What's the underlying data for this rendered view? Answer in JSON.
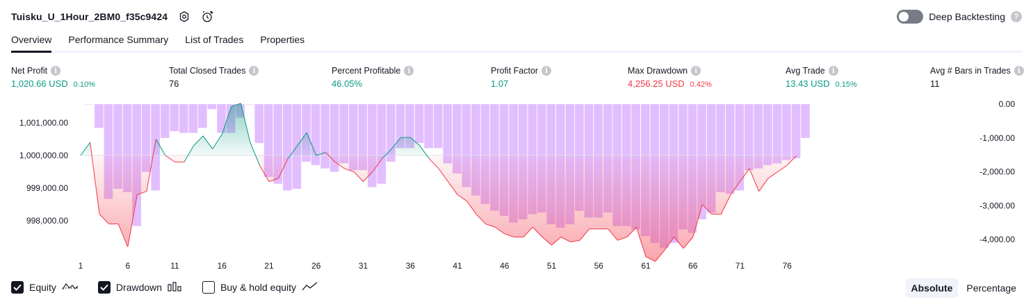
{
  "header": {
    "strategy_name": "Tuisku_U_1Hour_2BM0_f35c9424"
  },
  "deep_backtesting": {
    "label": "Deep Backtesting",
    "help": "?"
  },
  "tabs": [
    {
      "label": "Overview"
    },
    {
      "label": "Performance Summary"
    },
    {
      "label": "List of Trades"
    },
    {
      "label": "Properties"
    }
  ],
  "metrics": [
    {
      "label": "Net Profit",
      "value": "1,020.66 USD",
      "pct": "0.10%",
      "color": "#089981"
    },
    {
      "label": "Total Closed Trades",
      "value": "76",
      "pct": "",
      "color": "#131722"
    },
    {
      "label": "Percent Profitable",
      "value": "46.05%",
      "pct": "",
      "color": "#089981"
    },
    {
      "label": "Profit Factor",
      "value": "1.07",
      "pct": "",
      "color": "#089981"
    },
    {
      "label": "Max Drawdown",
      "value": "4,256.25 USD",
      "pct": "0.42%",
      "color": "#f23645"
    },
    {
      "label": "Avg Trade",
      "value": "13.43 USD",
      "pct": "0.15%",
      "color": "#089981"
    },
    {
      "label": "Avg # Bars in Trades",
      "value": "11",
      "pct": "",
      "color": "#131722"
    }
  ],
  "info_glyph": "i",
  "legend": {
    "equity": {
      "label": "Equity",
      "checked": true
    },
    "drawdown": {
      "label": "Drawdown",
      "checked": true
    },
    "buyhold": {
      "label": "Buy & hold equity",
      "checked": false
    }
  },
  "mode": {
    "absolute": "Absolute",
    "percentage": "Percentage",
    "active": "absolute"
  },
  "colors": {
    "profit": "#089981",
    "loss": "#f23645",
    "drawdown_bar": "#ce93ff",
    "text": "#131722",
    "muted": "#787b86"
  },
  "chart_data": {
    "type": "line",
    "x_ticks": [
      1,
      6,
      11,
      16,
      21,
      26,
      31,
      36,
      41,
      46,
      51,
      56,
      61,
      66,
      71,
      76
    ],
    "equity_axis": {
      "ticks": [
        1001000,
        1000000,
        999000,
        998000
      ],
      "tick_labels": [
        "1,001,000.00",
        "1,000,000.00",
        "999,000.00",
        "998,000.00"
      ],
      "baseline": 1000000
    },
    "drawdown_axis": {
      "ticks": [
        0,
        -1000,
        -2000,
        -3000,
        -4000
      ],
      "tick_labels": [
        "0.00",
        "-1,000.00",
        "-2,000.00",
        "-3,000.00",
        "-4,000.00"
      ]
    },
    "series": [
      {
        "name": "Equity",
        "x": [
          1,
          2,
          3,
          4,
          5,
          6,
          7,
          8,
          9,
          10,
          11,
          12,
          13,
          14,
          15,
          16,
          17,
          18,
          19,
          20,
          21,
          22,
          23,
          24,
          25,
          26,
          27,
          28,
          29,
          30,
          31,
          32,
          33,
          34,
          35,
          36,
          37,
          38,
          39,
          40,
          41,
          42,
          43,
          44,
          45,
          46,
          47,
          48,
          49,
          50,
          51,
          52,
          53,
          54,
          55,
          56,
          57,
          58,
          59,
          60,
          61,
          62,
          63,
          64,
          65,
          66,
          67,
          68,
          69,
          70,
          71,
          72,
          73,
          74,
          75,
          76,
          77
        ],
        "values": [
          1000000,
          1000400,
          998200,
          997900,
          997900,
          997200,
          998800,
          998900,
          1000500,
          1000000,
          999800,
          999800,
          1000300,
          1000600,
          1000200,
          1000650,
          1001500,
          1001600,
          1000400,
          999700,
          999200,
          999300,
          999900,
          1000300,
          1000700,
          1000000,
          1000100,
          999800,
          999600,
          999500,
          999200,
          999500,
          999900,
          1000200,
          1000550,
          1000550,
          1000300,
          999900,
          999600,
          999200,
          998800,
          998600,
          998200,
          997900,
          997800,
          997600,
          997500,
          997500,
          997800,
          997500,
          997250,
          997500,
          997350,
          997400,
          997750,
          997750,
          997750,
          997400,
          997500,
          997800,
          996900,
          996750,
          997100,
          997500,
          997150,
          997500,
          998500,
          998200,
          998200,
          998800,
          999200,
          999600,
          998900,
          999300,
          999500,
          999700,
          1000000
        ]
      },
      {
        "name": "Drawdown",
        "x": [
          1,
          2,
          3,
          4,
          5,
          6,
          7,
          8,
          9,
          10,
          11,
          12,
          13,
          14,
          15,
          16,
          17,
          18,
          19,
          20,
          21,
          22,
          23,
          24,
          25,
          26,
          27,
          28,
          29,
          30,
          31,
          32,
          33,
          34,
          35,
          36,
          37,
          38,
          39,
          40,
          41,
          42,
          43,
          44,
          45,
          46,
          47,
          48,
          49,
          50,
          51,
          52,
          53,
          54,
          55,
          56,
          57,
          58,
          59,
          60,
          61,
          62,
          63,
          64,
          65,
          66,
          67,
          68,
          69,
          70,
          71,
          72,
          73,
          74,
          75,
          76,
          77
        ],
        "values": [
          0,
          -700,
          -2800,
          -2500,
          -2600,
          -3600,
          -2000,
          -2550,
          -1000,
          -800,
          -850,
          -850,
          -700,
          -150,
          -850,
          -850,
          -400,
          0,
          -1150,
          -2150,
          -2350,
          -2550,
          -2500,
          -1700,
          -1800,
          -1900,
          -2000,
          -1750,
          -1950,
          -1950,
          -2450,
          -2350,
          -1700,
          -1300,
          -1300,
          -1150,
          -1300,
          -1300,
          -1750,
          -2050,
          -2450,
          -2700,
          -2950,
          -3150,
          -3300,
          -3500,
          -3400,
          -3250,
          -3200,
          -3550,
          -3650,
          -3550,
          -3150,
          -3350,
          -3350,
          -3200,
          -3600,
          -3600,
          -3700,
          -3900,
          -4100,
          -4250,
          -4100,
          -3700,
          -3800,
          -3400,
          -3200,
          -2600,
          -2650,
          -2550,
          -1950,
          -1900,
          -1800,
          -1750,
          -1650,
          -1600,
          -1000
        ]
      }
    ]
  }
}
